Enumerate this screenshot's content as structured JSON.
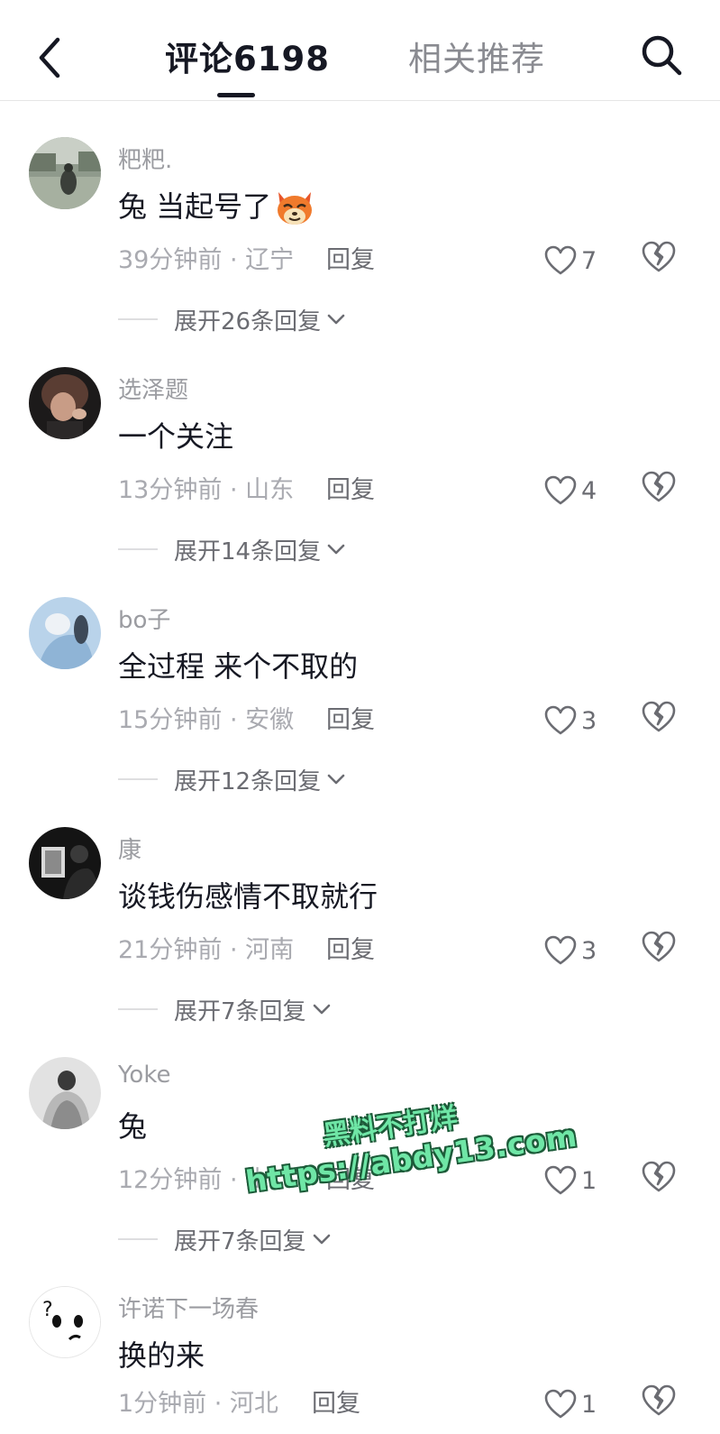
{
  "header": {
    "tab_comments": "评论6198",
    "tab_related": "相关推荐",
    "back_icon": "chevron-left-icon",
    "search_icon": "search-icon"
  },
  "comments": [
    {
      "username": "粑粑.",
      "content": "兔 当起号了",
      "emoji": "fox-emoji",
      "meta": "39分钟前 · 辽宁",
      "reply": "回复",
      "likes": "7",
      "expand": "展开26条回复"
    },
    {
      "username": "选泽题",
      "content": "一个关注",
      "meta": "13分钟前 · 山东",
      "reply": "回复",
      "likes": "4",
      "expand": "展开14条回复"
    },
    {
      "username": "bo子",
      "content": "全过程 来个不取的",
      "meta": "15分钟前 · 安徽",
      "reply": "回复",
      "likes": "3",
      "expand": "展开12条回复"
    },
    {
      "username": "康",
      "content": "谈钱伤感情不取就行",
      "meta": "21分钟前 · 河南",
      "reply": "回复",
      "likes": "3",
      "expand": "展开7条回复"
    },
    {
      "username": "Yoke",
      "content": "兔",
      "meta": "12分钟前 · 山",
      "reply": "回复",
      "likes": "1",
      "expand": "展开7条回复"
    },
    {
      "username": "许诺下一场春",
      "content": "换的来",
      "meta": "1分钟前 · 河北",
      "reply": "回复",
      "likes": "1",
      "expand": ""
    }
  ],
  "watermark": {
    "line1": "黑料不打烊",
    "line2": "https://abdy13.com"
  },
  "colors": {
    "primary_text": "#161823",
    "secondary_text": "#9b9ca1",
    "watermark": "#6fe6a6"
  }
}
